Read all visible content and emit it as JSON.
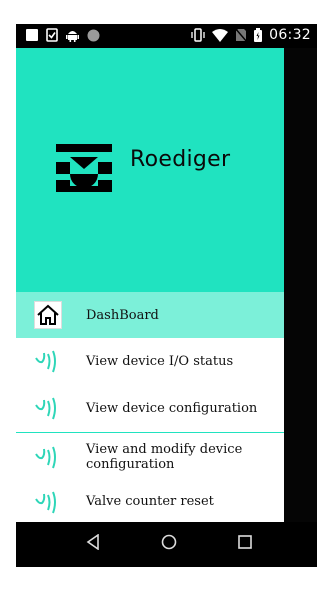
{
  "status_bar": {
    "time": "06:32"
  },
  "header": {
    "brand": "Roediger",
    "background_color": "#20e3c0"
  },
  "menu": {
    "items": [
      {
        "label": "DashBoard",
        "icon": "home-icon",
        "active": true
      },
      {
        "label": "View device I/O status",
        "icon": "nfc-wave-icon"
      },
      {
        "label": "View device configuration",
        "icon": "nfc-wave-icon"
      },
      {
        "label": "View and modify device configuration",
        "icon": "nfc-wave-icon"
      },
      {
        "label": "Valve counter reset",
        "icon": "nfc-wave-icon"
      }
    ]
  },
  "nav_bar": {
    "back": "back-icon",
    "home": "home-circle-icon",
    "recents": "recents-icon"
  },
  "colors": {
    "accent": "#20e3c0",
    "active_item": "#7cf0d9",
    "wave_icon": "#2ed6b8"
  }
}
